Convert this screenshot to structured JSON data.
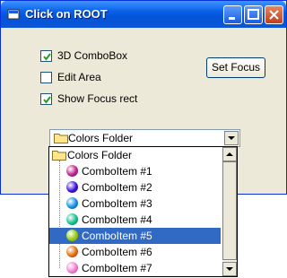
{
  "window": {
    "title": "Click on ROOT"
  },
  "checkboxes": [
    {
      "label": "3D ComboBox",
      "checked": true
    },
    {
      "label": "Edit Area",
      "checked": false
    },
    {
      "label": "Show Focus rect",
      "checked": true
    }
  ],
  "set_focus_label": "Set Focus",
  "combo": {
    "selected": "Colors Folder"
  },
  "dropdown": {
    "root": "Colors Folder",
    "items": [
      {
        "label": "ComboItem #1",
        "color": "#c0208a"
      },
      {
        "label": "ComboItem #2",
        "color": "#3b10d8"
      },
      {
        "label": "ComboItem #3",
        "color": "#1090e0"
      },
      {
        "label": "ComboItem #4",
        "color": "#10c090"
      },
      {
        "label": "ComboItem #5",
        "color": "#90d010",
        "selected": true
      },
      {
        "label": "ComboItem #6",
        "color": "#e07010"
      },
      {
        "label": "ComboItem #7",
        "color": "#f080d0"
      }
    ]
  },
  "colors": {
    "titlebar": "#0a5fe8",
    "selection": "#316ac5",
    "dialog": "#ece9d8"
  }
}
